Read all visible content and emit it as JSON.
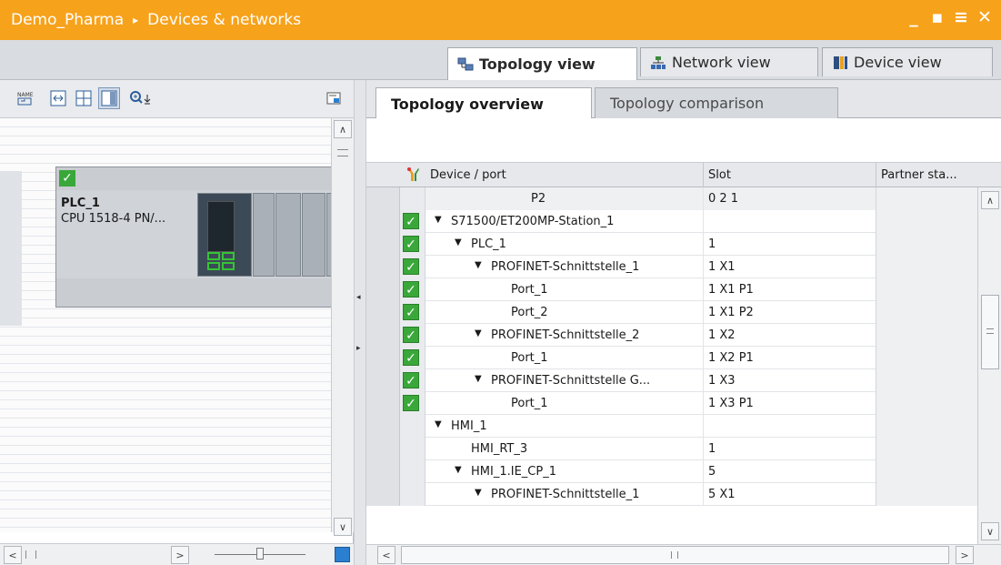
{
  "titlebar": {
    "project": "Demo_Pharma",
    "separator": "▸",
    "section": "Devices & networks",
    "controls": {
      "minimize": "_",
      "restore": "▪",
      "menu": "≡",
      "close": "✕"
    }
  },
  "view_tabs": [
    {
      "label": "Topology view",
      "icon": "topology-icon",
      "active": true
    },
    {
      "label": "Network view",
      "icon": "network-icon",
      "active": false
    },
    {
      "label": "Device view",
      "icon": "device-icon",
      "active": false
    }
  ],
  "left_toolbar": {
    "icons": [
      "name-display-icon",
      "fit-icon",
      "grid-icon",
      "table-toggle-icon",
      "zoom-icon",
      "overview-icon"
    ]
  },
  "device_card": {
    "name": "PLC_1",
    "type": "CPU 1518-4 PN/...",
    "checked": true
  },
  "sub_tabs": [
    {
      "label": "Topology overview",
      "active": true
    },
    {
      "label": "Topology comparison",
      "active": false
    }
  ],
  "table": {
    "headers": {
      "device_port": "Device / port",
      "slot": "Slot",
      "partner": "Partner sta..."
    },
    "rows": [
      {
        "indent": 4,
        "expander": "",
        "name": "P2",
        "slot": "0 2 1",
        "checked": false,
        "grey": true
      },
      {
        "indent": 0,
        "expander": "▼",
        "name": "S71500/ET200MP-Station_1",
        "slot": "",
        "checked": true,
        "grey": false
      },
      {
        "indent": 1,
        "expander": "▼",
        "name": "PLC_1",
        "slot": "1",
        "checked": true,
        "grey": false
      },
      {
        "indent": 2,
        "expander": "▼",
        "name": "PROFINET-Schnittstelle_1",
        "slot": "1 X1",
        "checked": true,
        "grey": false
      },
      {
        "indent": 3,
        "expander": "",
        "name": "Port_1",
        "slot": "1 X1 P1",
        "checked": true,
        "grey": false
      },
      {
        "indent": 3,
        "expander": "",
        "name": "Port_2",
        "slot": "1 X1 P2",
        "checked": true,
        "grey": false
      },
      {
        "indent": 2,
        "expander": "▼",
        "name": "PROFINET-Schnittstelle_2",
        "slot": "1 X2",
        "checked": true,
        "grey": false
      },
      {
        "indent": 3,
        "expander": "",
        "name": "Port_1",
        "slot": "1 X2 P1",
        "checked": true,
        "grey": false
      },
      {
        "indent": 2,
        "expander": "▼",
        "name": "PROFINET-Schnittstelle G...",
        "slot": "1 X3",
        "checked": true,
        "grey": false
      },
      {
        "indent": 3,
        "expander": "",
        "name": "Port_1",
        "slot": "1 X3 P1",
        "checked": true,
        "grey": false
      },
      {
        "indent": 0,
        "expander": "▼",
        "name": "HMI_1",
        "slot": "",
        "checked": false,
        "grey": false
      },
      {
        "indent": 1,
        "expander": "",
        "name": "HMI_RT_3",
        "slot": "1",
        "checked": false,
        "grey": false
      },
      {
        "indent": 1,
        "expander": "▼",
        "name": "HMI_1.IE_CP_1",
        "slot": "5",
        "checked": false,
        "grey": false
      },
      {
        "indent": 2,
        "expander": "▼",
        "name": "PROFINET-Schnittstelle_1",
        "slot": "5 X1",
        "checked": false,
        "grey": false
      }
    ]
  },
  "colors": {
    "titlebar": "#f7a21b",
    "check": "#3aa73a",
    "panel": "#e6e8eb"
  }
}
